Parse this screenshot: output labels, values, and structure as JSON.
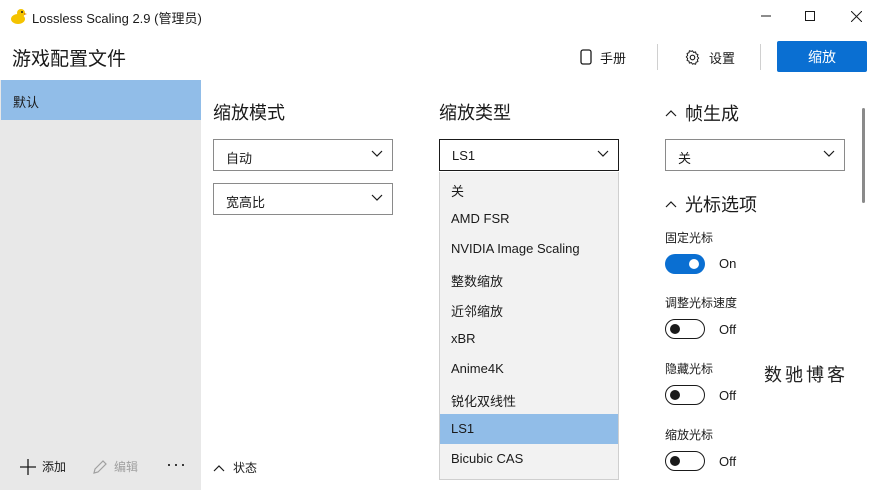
{
  "window": {
    "title": "Lossless Scaling 2.9 (管理员)"
  },
  "header": {
    "title": "游戏配置文件",
    "manual_label": "手册",
    "settings_label": "设置",
    "scale_label": "缩放"
  },
  "sidebar": {
    "items": [
      {
        "label": "默认",
        "selected": true
      }
    ],
    "add_label": "添加",
    "edit_label": "编辑",
    "more_label": "···"
  },
  "scaling_mode": {
    "title": "缩放模式",
    "mode_value": "自动",
    "aspect_value": "宽高比"
  },
  "scaling_type": {
    "title": "缩放类型",
    "selected_value": "LS1",
    "options": [
      {
        "label": "关"
      },
      {
        "label": "AMD FSR"
      },
      {
        "label": "NVIDIA Image Scaling"
      },
      {
        "label": "整数缩放"
      },
      {
        "label": "近邻缩放"
      },
      {
        "label": "xBR"
      },
      {
        "label": "Anime4K"
      },
      {
        "label": "锐化双线性"
      },
      {
        "label": "LS1",
        "selected": true
      },
      {
        "label": "Bicubic CAS"
      }
    ]
  },
  "frame_gen": {
    "title": "帧生成",
    "value": "关"
  },
  "cursor": {
    "title": "光标选项",
    "options": [
      {
        "label": "固定光标",
        "state": "On",
        "on": true
      },
      {
        "label": "调整光标速度",
        "state": "Off",
        "on": false
      },
      {
        "label": "隐藏光标",
        "state": "Off",
        "on": false
      },
      {
        "label": "缩放光标",
        "state": "Off",
        "on": false
      }
    ]
  },
  "status": {
    "label": "状态"
  },
  "watermark": "数驰博客",
  "colors": {
    "accent": "#0a6fd2",
    "selection": "#91bde8",
    "sidebar_bg": "#e8e8e8"
  }
}
